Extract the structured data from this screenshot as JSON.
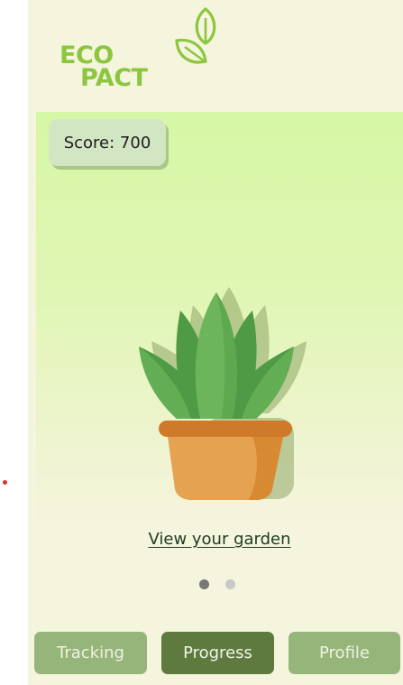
{
  "logo": {
    "line1": "ECO",
    "line2": "PACT",
    "icon": "leaf-logo-icon"
  },
  "score": {
    "label": "Score: 700"
  },
  "garden": {
    "link_label": "View your garden",
    "illustration": "potted-plant-icon"
  },
  "pager": {
    "active_index": 0,
    "total": 2
  },
  "tabs": [
    {
      "label": "Tracking",
      "active": false
    },
    {
      "label": "Progress",
      "active": true
    },
    {
      "label": "Profile",
      "active": false
    }
  ],
  "colors": {
    "app_bg": "#f5f4dd",
    "card_top": "#d6f7a5",
    "logo_green": "#8cc63f",
    "tab_active": "#5e7a3f",
    "tab_inactive": "#96b57b",
    "pot": "#e5a251",
    "leaf": "#5ea84f"
  }
}
